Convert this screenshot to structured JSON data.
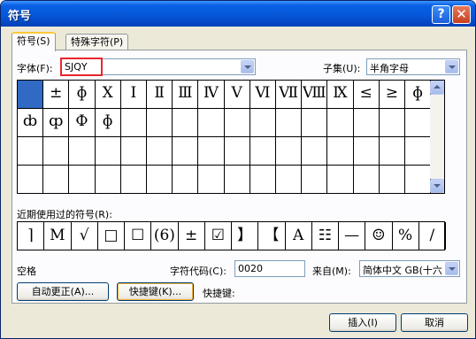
{
  "window": {
    "title": "符号"
  },
  "titlebar": {
    "help": "?",
    "close": "✕"
  },
  "tabs": [
    {
      "label": "符号(S)"
    },
    {
      "label": "特殊字符(P)"
    }
  ],
  "font": {
    "label": "字体(F):",
    "value": "SJQY"
  },
  "subset": {
    "label": "子集(U):",
    "value": "半角字母"
  },
  "symbols": {
    "rows": [
      [
        "",
        "±",
        "ɸ",
        "Ⅹ",
        "Ⅰ",
        "Ⅱ",
        "Ⅲ",
        "Ⅳ",
        "Ⅴ",
        "Ⅵ",
        "Ⅶ",
        "Ⅷ",
        "Ⅸ",
        "≤",
        "≥",
        "ɸ"
      ],
      [
        "ȸ",
        "ȹ",
        "Ф",
        "ɸ",
        "",
        "",
        "",
        "",
        "",
        "",
        "",
        "",
        "",
        "",
        "",
        ""
      ],
      [
        "",
        "",
        "",
        "",
        "",
        "",
        "",
        "",
        "",
        "",
        "",
        "",
        "",
        "",
        "",
        ""
      ],
      [
        "",
        "",
        "",
        "",
        "",
        "",
        "",
        "",
        "",
        "",
        "",
        "",
        "",
        "",
        "",
        ""
      ]
    ]
  },
  "recent": {
    "label": "近期使用过的符号(R):",
    "items": [
      "⌉",
      "M",
      "√",
      "□",
      "☐",
      "(6)",
      "±",
      "☑",
      "】",
      "【",
      "A",
      "☷",
      "—",
      "☺",
      "%",
      "/"
    ]
  },
  "status": {
    "name": "空格",
    "charcode_label": "字符代码(C):",
    "charcode_value": "0020",
    "from_label": "来自(M):",
    "from_value": "简体中文 GB(十六"
  },
  "buttons": {
    "autocorrect": "自动更正(A)...",
    "shortcut": "快捷键(K)...",
    "shortcut_label": "快捷键:",
    "insert": "插入(I)",
    "cancel": "取消"
  }
}
